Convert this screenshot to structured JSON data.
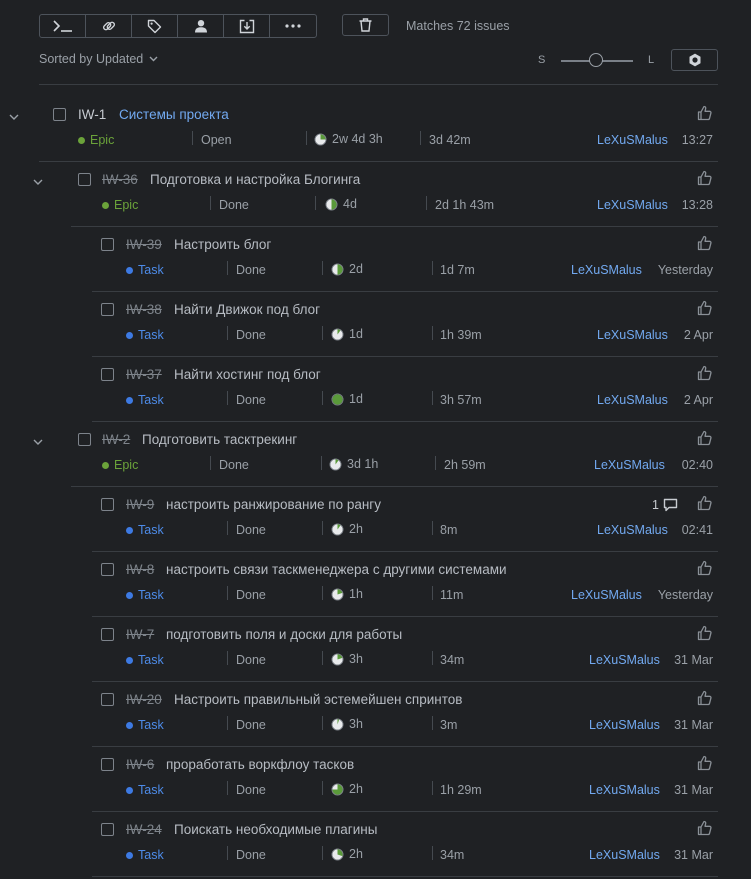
{
  "toolbar": {
    "buttons": [
      {
        "name": "command-icon"
      },
      {
        "name": "link-icon"
      },
      {
        "name": "tag-icon"
      },
      {
        "name": "assignee-icon"
      },
      {
        "name": "move-icon"
      },
      {
        "name": "more-icon"
      }
    ],
    "matches": "Matches 72 issues"
  },
  "sort": {
    "label": "Sorted by Updated"
  },
  "size": {
    "small": "S",
    "large": "L"
  },
  "colors": {
    "background": "#1f2124",
    "link": "#72a9f0",
    "epic": "#6ba33a",
    "task": "#3d7ae3"
  },
  "issues": [
    {
      "level": 0,
      "expand": true,
      "id": "IW-1",
      "strike": false,
      "summary": "Системы проекта",
      "link": true,
      "type": "Epic",
      "state": "Open",
      "estimate": "2w 4d 3h",
      "spent": "3d 42m",
      "assignee": "LeXuSMalus",
      "updated": "13:27",
      "comments": "",
      "progress": 0.25
    },
    {
      "level": 1,
      "expand": true,
      "id": "IW-36",
      "strike": true,
      "summary": "Подготовка и настройка Блогинга",
      "link": false,
      "type": "Epic",
      "state": "Done",
      "estimate": "4d",
      "spent": "2d 1h 43m",
      "assignee": "LeXuSMalus",
      "updated": "13:28",
      "comments": "",
      "progress": 0.5
    },
    {
      "level": 2,
      "expand": false,
      "id": "IW-39",
      "strike": true,
      "summary": "Настроить блог",
      "link": false,
      "type": "Task",
      "state": "Done",
      "estimate": "2d",
      "spent": "1d 7m",
      "assignee": "LeXuSMalus",
      "updated": "Yesterday",
      "comments": "",
      "progress": 0.5
    },
    {
      "level": 2,
      "expand": false,
      "id": "IW-38",
      "strike": true,
      "summary": "Найти Движок под блог",
      "link": false,
      "type": "Task",
      "state": "Done",
      "estimate": "1d",
      "spent": "1h 39m",
      "assignee": "LeXuSMalus",
      "updated": "2 Apr",
      "comments": "",
      "progress": 0.1
    },
    {
      "level": 2,
      "expand": false,
      "id": "IW-37",
      "strike": true,
      "summary": "Найти хостинг под блог",
      "link": false,
      "type": "Task",
      "state": "Done",
      "estimate": "1d",
      "spent": "3h 57m",
      "assignee": "LeXuSMalus",
      "updated": "2 Apr",
      "comments": "",
      "progress": 1
    },
    {
      "level": 1,
      "expand": true,
      "id": "IW-2",
      "strike": true,
      "summary": "Подготовить тасктрекинг",
      "link": false,
      "type": "Epic",
      "state": "Done",
      "estimate": "3d 1h",
      "spent": "2h 59m",
      "assignee": "LeXuSMalus",
      "updated": "02:40",
      "comments": "",
      "progress": 0.1
    },
    {
      "level": 2,
      "expand": false,
      "id": "IW-9",
      "strike": true,
      "summary": "настроить ранжирование по рангу",
      "link": false,
      "type": "Task",
      "state": "Done",
      "estimate": "2h",
      "spent": "8m",
      "assignee": "LeXuSMalus",
      "updated": "02:41",
      "comments": "1",
      "progress": 0.1
    },
    {
      "level": 2,
      "expand": false,
      "id": "IW-8",
      "strike": true,
      "summary": "настроить связи таскменеджера с другими системами",
      "link": false,
      "type": "Task",
      "state": "Done",
      "estimate": "1h",
      "spent": "11m",
      "assignee": "LeXuSMalus",
      "updated": "Yesterday",
      "comments": "",
      "progress": 0.2
    },
    {
      "level": 2,
      "expand": false,
      "id": "IW-7",
      "strike": true,
      "summary": "подготовить поля и доски для работы",
      "link": false,
      "type": "Task",
      "state": "Done",
      "estimate": "3h",
      "spent": "34m",
      "assignee": "LeXuSMalus",
      "updated": "31 Mar",
      "comments": "",
      "progress": 0.2
    },
    {
      "level": 2,
      "expand": false,
      "id": "IW-20",
      "strike": true,
      "summary": "Настроить правильный эстемейшен спринтов",
      "link": false,
      "type": "Task",
      "state": "Done",
      "estimate": "3h",
      "spent": "3m",
      "assignee": "LeXuSMalus",
      "updated": "31 Mar",
      "comments": "",
      "progress": 0.05
    },
    {
      "level": 2,
      "expand": false,
      "id": "IW-6",
      "strike": true,
      "summary": "проработать воркфлоу тасков",
      "link": false,
      "type": "Task",
      "state": "Done",
      "estimate": "2h",
      "spent": "1h 29m",
      "assignee": "LeXuSMalus",
      "updated": "31 Mar",
      "comments": "",
      "progress": 0.75
    },
    {
      "level": 2,
      "expand": false,
      "id": "IW-24",
      "strike": true,
      "summary": "Поискать необходимые плагины",
      "link": false,
      "type": "Task",
      "state": "Done",
      "estimate": "2h",
      "spent": "34m",
      "assignee": "LeXuSMalus",
      "updated": "31 Mar",
      "comments": "",
      "progress": 0.3
    }
  ]
}
